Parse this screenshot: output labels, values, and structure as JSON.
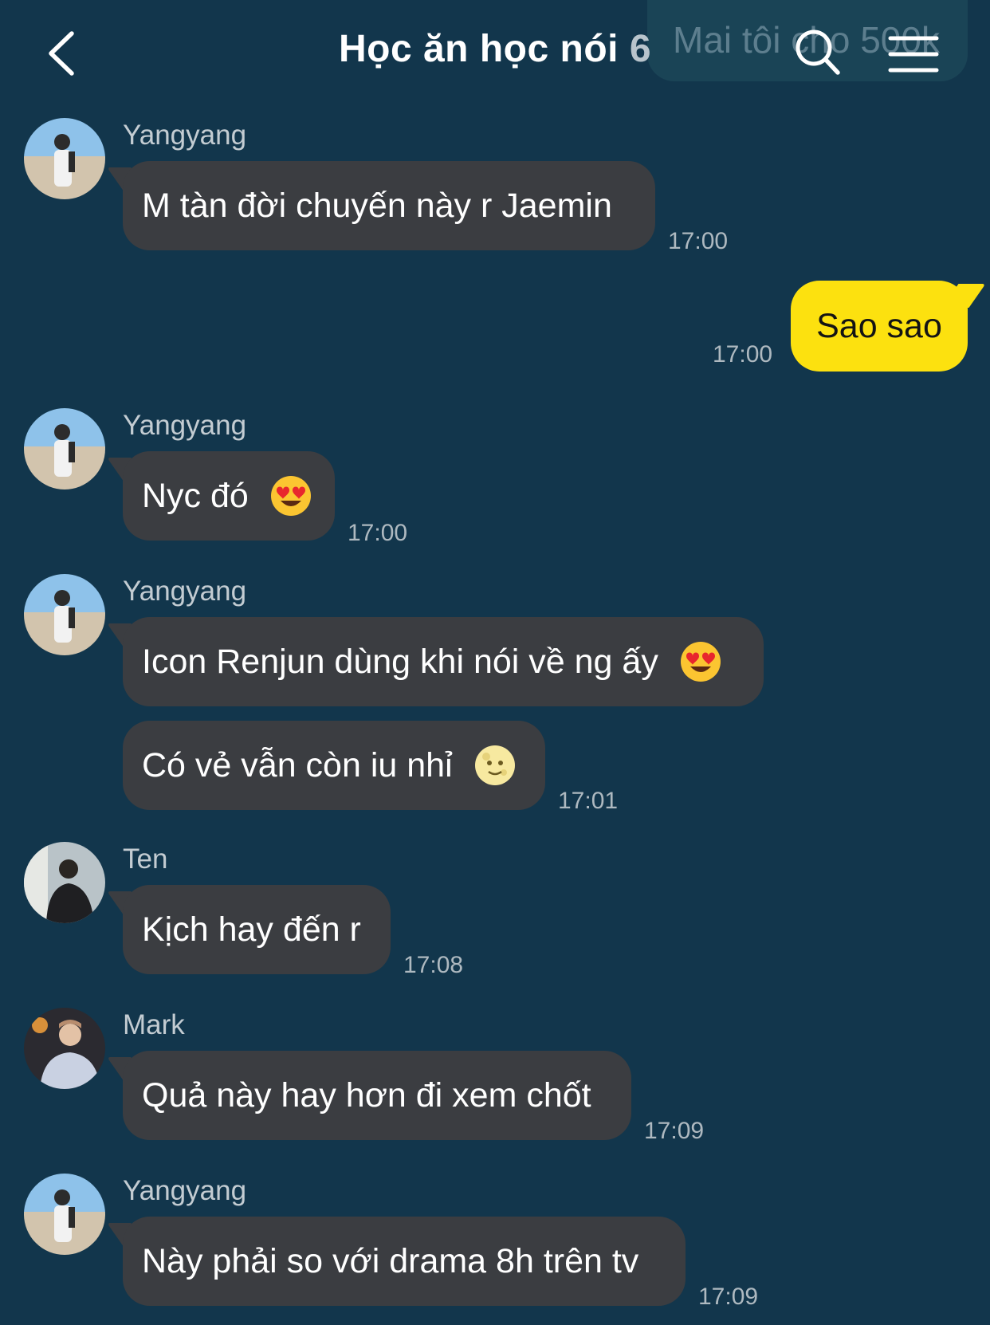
{
  "header": {
    "title": "Học ăn học nói",
    "member_count": "6",
    "pinned_preview": "Mai tôi cho 500k"
  },
  "messages": [
    {
      "sender": "Yangyang",
      "text": "M tàn đời chuyến này r Jaemin",
      "time": "17:00"
    },
    {
      "sender": "me",
      "text": "Sao sao",
      "time": "17:00"
    },
    {
      "sender": "Yangyang",
      "text": "Nyc đó",
      "emoji": "heart-eyes",
      "time": "17:00"
    },
    {
      "sender": "Yangyang",
      "text": "Icon Renjun dùng khi nói về ng ấy",
      "emoji": "heart-eyes"
    },
    {
      "sender": "Yangyang",
      "text": "Có vẻ vẫn còn iu nhỉ",
      "emoji": "full-moon-face",
      "time": "17:01"
    },
    {
      "sender": "Ten",
      "text": "Kịch hay đến r",
      "time": "17:08"
    },
    {
      "sender": "Mark",
      "text": "Quả này hay hơn đi xem chốt",
      "time": "17:09"
    },
    {
      "sender": "Yangyang",
      "text": "Này phải so với drama 8h trên tv",
      "time": "17:09"
    }
  ],
  "colors": {
    "background": "#12364c",
    "bubble_other": "#3b3d41",
    "bubble_me": "#fce10f"
  },
  "icons": [
    "back-icon",
    "search-icon",
    "menu-icon",
    "heart-eyes-emoji",
    "full-moon-face-emoji"
  ]
}
